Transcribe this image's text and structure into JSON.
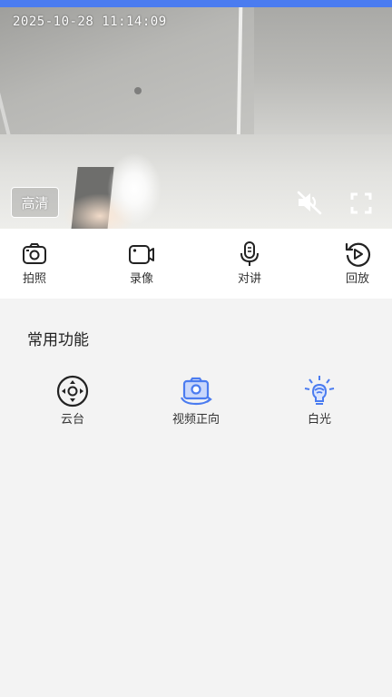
{
  "status_bar": {
    "color": "#4b7cf0"
  },
  "video": {
    "timestamp": "2025-10-28  11:14:09",
    "quality_label": "高清",
    "mute_icon": "speaker-muted-icon",
    "fullscreen_icon": "fullscreen-icon"
  },
  "toolbar": {
    "items": [
      {
        "label": "拍照",
        "icon": "camera-icon"
      },
      {
        "label": "录像",
        "icon": "video-record-icon"
      },
      {
        "label": "对讲",
        "icon": "microphone-icon"
      },
      {
        "label": "回放",
        "icon": "playback-icon"
      }
    ]
  },
  "functions": {
    "title": "常用功能",
    "items": [
      {
        "label": "云台",
        "icon": "ptz-direction-icon"
      },
      {
        "label": "视频正向",
        "icon": "camera-rotate-icon"
      },
      {
        "label": "白光",
        "icon": "light-bulb-icon"
      }
    ],
    "accent_color": "#4b7cf0",
    "icon_color": "#222222"
  }
}
